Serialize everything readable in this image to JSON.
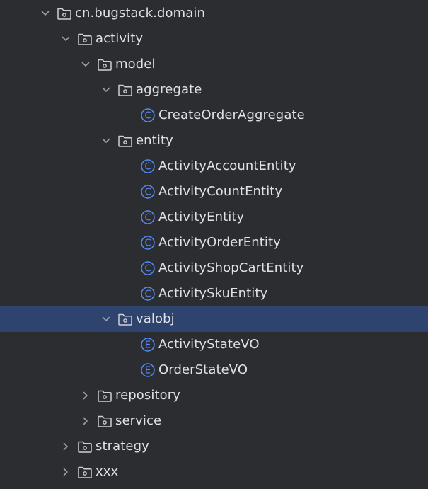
{
  "tree": {
    "root": {
      "label": "cn.bugstack.domain",
      "icon": "package-folder-icon",
      "expanded": true
    },
    "activity": {
      "label": "activity",
      "icon": "package-folder-icon",
      "expanded": true
    },
    "model": {
      "label": "model",
      "icon": "package-folder-icon",
      "expanded": true
    },
    "aggregate": {
      "label": "aggregate",
      "icon": "package-folder-icon",
      "expanded": true
    },
    "create_order_aggregate": {
      "label": "CreateOrderAggregate",
      "icon": "class-icon",
      "glyph": "C"
    },
    "entity": {
      "label": "entity",
      "icon": "package-folder-icon",
      "expanded": true
    },
    "entities": [
      {
        "label": "ActivityAccountEntity",
        "icon": "class-icon",
        "glyph": "C"
      },
      {
        "label": "ActivityCountEntity",
        "icon": "class-icon",
        "glyph": "C"
      },
      {
        "label": "ActivityEntity",
        "icon": "class-icon",
        "glyph": "C"
      },
      {
        "label": "ActivityOrderEntity",
        "icon": "class-icon",
        "glyph": "C"
      },
      {
        "label": "ActivityShopCartEntity",
        "icon": "class-icon",
        "glyph": "C"
      },
      {
        "label": "ActivitySkuEntity",
        "icon": "class-icon",
        "glyph": "C"
      }
    ],
    "valobj": {
      "label": "valobj",
      "icon": "package-folder-icon",
      "expanded": true,
      "selected": true
    },
    "enums": [
      {
        "label": "ActivityStateVO",
        "icon": "enum-icon",
        "glyph": "E"
      },
      {
        "label": "OrderStateVO",
        "icon": "enum-icon",
        "glyph": "E"
      }
    ],
    "repository": {
      "label": "repository",
      "icon": "package-folder-icon",
      "expanded": false
    },
    "service": {
      "label": "service",
      "icon": "package-folder-icon",
      "expanded": false
    },
    "strategy": {
      "label": "strategy",
      "icon": "package-folder-icon",
      "expanded": false
    },
    "xxx": {
      "label": "xxx",
      "icon": "package-folder-icon",
      "expanded": false
    }
  },
  "colors": {
    "background": "#2b2d30",
    "selection": "#2e436e",
    "text": "#dfe1e5",
    "chevron": "#9da0a8",
    "folder": "#ced0d6",
    "class_icon": "#548af7"
  }
}
